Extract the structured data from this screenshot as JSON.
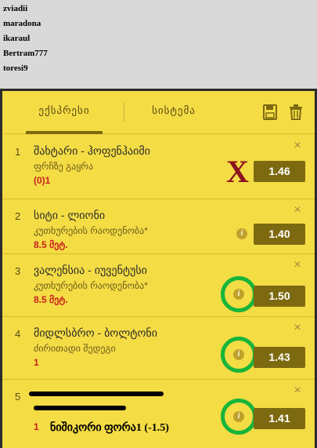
{
  "users": [
    "zviadii",
    "maradona",
    "ikaraul",
    "Bertram777",
    "toresi9"
  ],
  "tabs": {
    "express": "ექსპრესი",
    "system": "სისტემა"
  },
  "bets": [
    {
      "num": "1",
      "match": "შახტარი - ჰოფენჰაიმი",
      "market": "ფრჩზე გაყრა",
      "selection": "(0)1",
      "odds": "1.46"
    },
    {
      "num": "2",
      "match": "სიტი - ლიონი",
      "market": "კუთხურების რაოდენობა*",
      "selection": "8.5 მეტ.",
      "odds": "1.40"
    },
    {
      "num": "3",
      "match": "ვალენსია - იუვენტუსი",
      "market": "კუთხურების რაოდენობა*",
      "selection": "8.5 მეტ.",
      "odds": "1.50"
    },
    {
      "num": "4",
      "match": "მიდლსბრო - ბოლტონი",
      "market": "ძირითადი შედეგი",
      "selection": "1",
      "odds": "1.43"
    },
    {
      "num": "5",
      "match": "",
      "market": "",
      "selection": "1",
      "odds": "1.41"
    }
  ],
  "annotations": {
    "handwritten_note": "ნიშიკორი ფორა1 (-1.5)",
    "red_x": "X"
  },
  "colors": {
    "slip_bg": "#f4dc45",
    "odds_bg": "#7d6a10",
    "selection_red": "#c9201d",
    "highlight_green": "#17b53a",
    "red_x": "#8b1420"
  },
  "icons": {
    "save": "floppy-disk-icon",
    "delete": "trash-icon",
    "close": "close-icon",
    "info": "info-icon"
  }
}
